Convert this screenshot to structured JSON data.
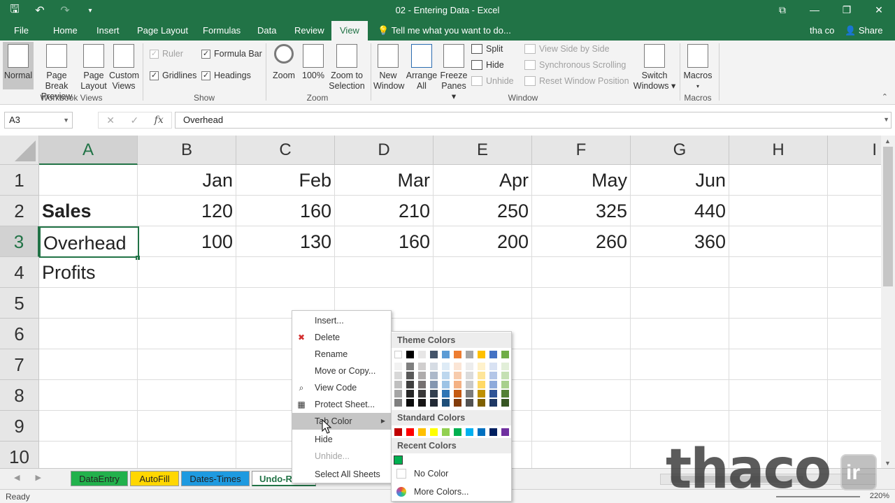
{
  "window": {
    "title": "02 - Entering Data - Excel",
    "undo_label": "↶",
    "controls": [
      "⧉",
      "—",
      "❐",
      "✕"
    ]
  },
  "ribbon_tabs": [
    "File",
    "Home",
    "Insert",
    "Page Layout",
    "Formulas",
    "Data",
    "Review",
    "View"
  ],
  "active_tab": "View",
  "tell_me": "Tell me what you want to do...",
  "user": "tha co",
  "share": "Share",
  "workbook_views": {
    "group": "Workbook Views",
    "normal": "Normal",
    "page_break": [
      "Page Break",
      "Preview"
    ],
    "page_layout": [
      "Page",
      "Layout"
    ],
    "custom_views": [
      "Custom",
      "Views"
    ]
  },
  "show": {
    "group": "Show",
    "ruler": "Ruler",
    "formula_bar": "Formula Bar",
    "gridlines": "Gridlines",
    "headings": "Headings"
  },
  "zoom_group": {
    "group": "Zoom",
    "zoom": "Zoom",
    "hundred": "100%",
    "zoom_selection": [
      "Zoom to",
      "Selection"
    ]
  },
  "window_group": {
    "group": "Window",
    "new_window": [
      "New",
      "Window"
    ],
    "arrange_all": [
      "Arrange",
      "All"
    ],
    "freeze_panes": [
      "Freeze",
      "Panes ▾"
    ],
    "split": "Split",
    "hide": "Hide",
    "unhide": "Unhide",
    "side_by_side": "View Side by Side",
    "sync_scroll": "Synchronous Scrolling",
    "reset_pos": "Reset Window Position",
    "switch_windows": [
      "Switch",
      "Windows ▾"
    ]
  },
  "macros_group": {
    "group": "Macros",
    "macros": "Macros"
  },
  "name_box": "A3",
  "formula_value": "Overhead",
  "fx_symbol": "fx",
  "columns": [
    "A",
    "B",
    "C",
    "D",
    "E",
    "F",
    "G",
    "H",
    "I"
  ],
  "rows": [
    "1",
    "2",
    "3",
    "4",
    "5",
    "6",
    "7",
    "8",
    "9",
    "10"
  ],
  "cells": {
    "b1": "Jan",
    "c1": "Feb",
    "d1": "Mar",
    "e1": "Apr",
    "f1": "May",
    "g1": "Jun",
    "a2": "Sales",
    "b2": "120",
    "c2": "160",
    "d2": "210",
    "e2": "250",
    "f2": "325",
    "g2": "440",
    "a3": "Overhead",
    "b3": "100",
    "c3": "130",
    "d3": "160",
    "e3": "200",
    "f3": "260",
    "g3": "360",
    "a4": "Profits"
  },
  "sheet_tabs": [
    {
      "label": "DataEntry",
      "color": "#22b14c"
    },
    {
      "label": "AutoFill",
      "color": "#ffd700"
    },
    {
      "label": "Dates-Times",
      "color": "#1e9ae0"
    },
    {
      "label": "Undo-R",
      "color": "#ffffff"
    }
  ],
  "context_menu": {
    "insert": "Insert...",
    "delete": "Delete",
    "rename": "Rename",
    "move_copy": "Move or Copy...",
    "view_code": "View Code",
    "protect": "Protect Sheet...",
    "tab_color": "Tab Color",
    "hide": "Hide",
    "unhide": "Unhide...",
    "select_all": "Select All Sheets"
  },
  "color_picker": {
    "theme_header": "Theme Colors",
    "standard_header": "Standard Colors",
    "recent_header": "Recent Colors",
    "no_color": "No Color",
    "more_colors": "More Colors...",
    "theme_top": [
      "#ffffff",
      "#000000",
      "#e7e6e6",
      "#44546a",
      "#5b9bd5",
      "#ed7d31",
      "#a5a5a5",
      "#ffc000",
      "#4472c4",
      "#70ad47"
    ],
    "theme_shades": [
      [
        "#f2f2f2",
        "#7f7f7f",
        "#d0cece",
        "#d6dce4",
        "#deebf6",
        "#fbe5d5",
        "#ededed",
        "#fff2cc",
        "#d9e2f3",
        "#e2efd9"
      ],
      [
        "#d8d8d8",
        "#595959",
        "#aeabab",
        "#adb9ca",
        "#bdd7ee",
        "#f7cbac",
        "#dbdbdb",
        "#fee599",
        "#b4c6e7",
        "#c5e0b3"
      ],
      [
        "#bfbfbf",
        "#3f3f3f",
        "#757070",
        "#8496b0",
        "#9cc3e5",
        "#f4b183",
        "#c9c9c9",
        "#ffd965",
        "#8eaadb",
        "#a8d08d"
      ],
      [
        "#a5a5a5",
        "#262626",
        "#3a3838",
        "#323f4f",
        "#2e75b5",
        "#c55a11",
        "#7b7b7b",
        "#bf9000",
        "#2f5496",
        "#538135"
      ],
      [
        "#7f7f7f",
        "#0c0c0c",
        "#171616",
        "#222a35",
        "#1e4e79",
        "#833c0b",
        "#525252",
        "#7f6000",
        "#1f3864",
        "#375623"
      ]
    ],
    "standard": [
      "#c00000",
      "#ff0000",
      "#ffc000",
      "#ffff00",
      "#92d050",
      "#00b050",
      "#00b0f0",
      "#0070c0",
      "#002060",
      "#7030a0"
    ],
    "recent": [
      "#00b050"
    ]
  },
  "status": "Ready",
  "zoom_level": "220%",
  "watermark": "thaco",
  "watermark_ir": "ir"
}
